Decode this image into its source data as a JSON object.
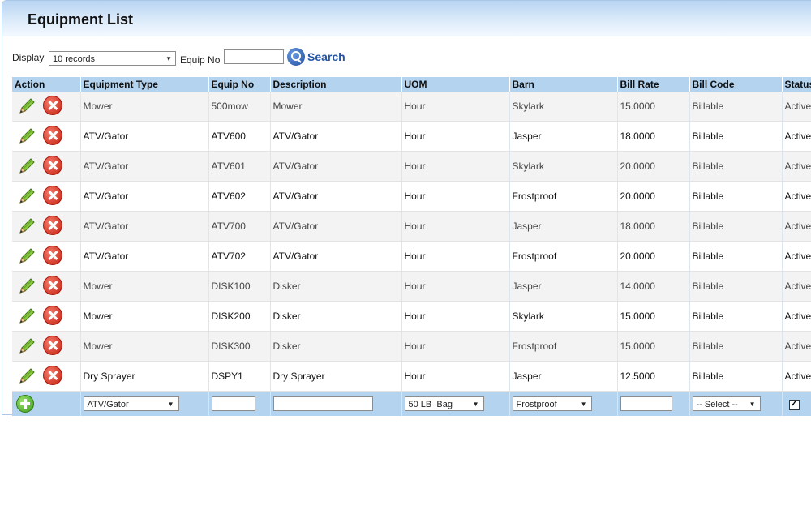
{
  "page": {
    "title": "Equipment List"
  },
  "filter": {
    "display_label": "Display",
    "display_value": "10 records",
    "equip_label": "Equip No",
    "equip_value": "",
    "search_label": "Search"
  },
  "table": {
    "columns": [
      "Action",
      "Equipment Type",
      "Equip No",
      "Description",
      "UOM",
      "Barn",
      "Bill Rate",
      "Bill Code",
      "Status"
    ],
    "rows": [
      {
        "type": "Mower",
        "equip_no": "500mow",
        "description": "Mower",
        "uom": "Hour",
        "barn": "Skylark",
        "bill_rate": "15.0000",
        "bill_code": "Billable",
        "status": "Active"
      },
      {
        "type": "ATV/Gator",
        "equip_no": "ATV600",
        "description": "ATV/Gator",
        "uom": "Hour",
        "barn": "Jasper",
        "bill_rate": "18.0000",
        "bill_code": "Billable",
        "status": "Active"
      },
      {
        "type": "ATV/Gator",
        "equip_no": "ATV601",
        "description": "ATV/Gator",
        "uom": "Hour",
        "barn": "Skylark",
        "bill_rate": "20.0000",
        "bill_code": "Billable",
        "status": "Active"
      },
      {
        "type": "ATV/Gator",
        "equip_no": "ATV602",
        "description": "ATV/Gator",
        "uom": "Hour",
        "barn": "Frostproof",
        "bill_rate": "20.0000",
        "bill_code": "Billable",
        "status": "Active"
      },
      {
        "type": "ATV/Gator",
        "equip_no": "ATV700",
        "description": "ATV/Gator",
        "uom": "Hour",
        "barn": "Jasper",
        "bill_rate": "18.0000",
        "bill_code": "Billable",
        "status": "Active"
      },
      {
        "type": "ATV/Gator",
        "equip_no": "ATV702",
        "description": "ATV/Gator",
        "uom": "Hour",
        "barn": "Frostproof",
        "bill_rate": "20.0000",
        "bill_code": "Billable",
        "status": "Active"
      },
      {
        "type": "Mower",
        "equip_no": "DISK100",
        "description": "Disker",
        "uom": "Hour",
        "barn": "Jasper",
        "bill_rate": "14.0000",
        "bill_code": "Billable",
        "status": "Active"
      },
      {
        "type": "Mower",
        "equip_no": "DISK200",
        "description": "Disker",
        "uom": "Hour",
        "barn": "Skylark",
        "bill_rate": "15.0000",
        "bill_code": "Billable",
        "status": "Active"
      },
      {
        "type": "Mower",
        "equip_no": "DISK300",
        "description": "Disker",
        "uom": "Hour",
        "barn": "Frostproof",
        "bill_rate": "15.0000",
        "bill_code": "Billable",
        "status": "Active"
      },
      {
        "type": "Dry Sprayer",
        "equip_no": "DSPY1",
        "description": "Dry Sprayer",
        "uom": "Hour",
        "barn": "Jasper",
        "bill_rate": "12.5000",
        "bill_code": "Billable",
        "status": "Active"
      }
    ],
    "new_row": {
      "type_value": "ATV/Gator",
      "uom_value": "50 LB  Bag",
      "barn_value": "Frostproof",
      "bill_code_value": "-- Select --",
      "status_checked": "✓"
    }
  },
  "icons": {
    "edit": "pencil-icon",
    "delete": "delete-icon",
    "add": "add-icon",
    "search": "magnifier-icon"
  }
}
